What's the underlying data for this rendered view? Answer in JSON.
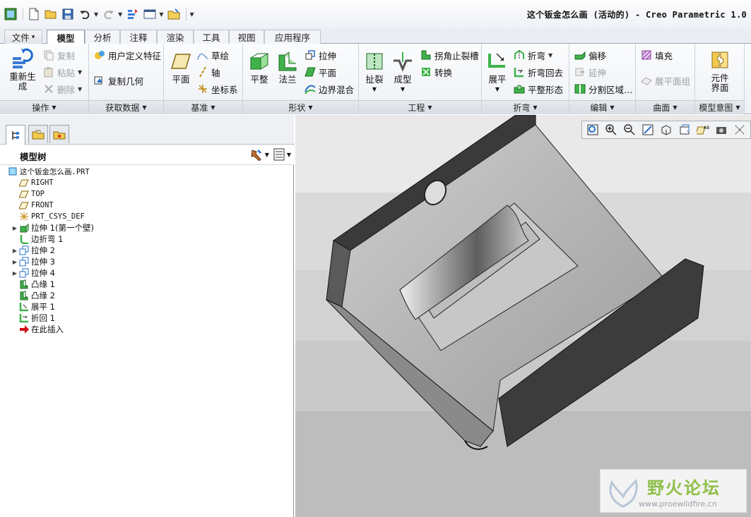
{
  "window": {
    "title": "这个钣金怎么画 (活动的) - Creo Parametric 1.0"
  },
  "tabs": [
    {
      "label": "文件",
      "dropdown": "▾"
    },
    {
      "label": "模型"
    },
    {
      "label": "分析"
    },
    {
      "label": "注释"
    },
    {
      "label": "渲染"
    },
    {
      "label": "工具"
    },
    {
      "label": "视图"
    },
    {
      "label": "应用程序"
    }
  ],
  "ribbon": {
    "groups": {
      "operations": {
        "label": "操作",
        "regenerate_line1": "重新生",
        "regenerate_line2": "成",
        "copy": "复制",
        "paste": "粘贴",
        "delete": "删除"
      },
      "get_data": {
        "label": "获取数据",
        "udf": "用户定义特征",
        "copy_geom": "复制几何"
      },
      "datum": {
        "label": "基准",
        "plane": "平面",
        "sketch": "草绘",
        "axis": "轴",
        "csys": "坐标系"
      },
      "shapes": {
        "label": "形状",
        "flat": "平整",
        "flange": "法兰",
        "extrude": "拉伸",
        "planar": "平面",
        "boundary_blend": "边界混合"
      },
      "engineering": {
        "label": "工程",
        "rip": "扯裂",
        "form": "成型",
        "corner_relief": "拐角止裂槽",
        "convert": "转换"
      },
      "bend": {
        "label": "折弯",
        "unbend": "展平",
        "bend": "折弯",
        "bend_back": "折弯回去",
        "flatten_form": "平整形态"
      },
      "edit": {
        "label": "编辑",
        "offset": "偏移",
        "extend": "延伸",
        "split_area": "分割区域…"
      },
      "surfaces": {
        "label": "曲面",
        "fill": "填充",
        "flat_quilt": "展平面组"
      },
      "model_intent": {
        "label": "模型意图",
        "component_line1": "元件",
        "component_line2": "界面"
      }
    }
  },
  "panel": {
    "tree_title": "模型树",
    "tree": [
      {
        "label": "这个钣金怎么画.PRT",
        "icon": "part-icon",
        "exp": ""
      },
      {
        "label": "RIGHT",
        "icon": "datum-plane-icon",
        "exp": ""
      },
      {
        "label": "TOP",
        "icon": "datum-plane-icon",
        "exp": ""
      },
      {
        "label": "FRONT",
        "icon": "datum-plane-icon",
        "exp": ""
      },
      {
        "label": "PRT_CSYS_DEF",
        "icon": "csys-icon",
        "exp": ""
      },
      {
        "label": "拉伸 1(第一个壁)",
        "icon": "first-wall-icon",
        "exp": "▶"
      },
      {
        "label": "边折弯 1",
        "icon": "edge-bend-icon",
        "exp": ""
      },
      {
        "label": "拉伸 2",
        "icon": "extrude-cut-icon",
        "exp": "▶"
      },
      {
        "label": "拉伸 3",
        "icon": "extrude-cut-icon",
        "exp": "▶"
      },
      {
        "label": "拉伸 4",
        "icon": "extrude-cut-icon",
        "exp": "▶"
      },
      {
        "label": "凸缘 1",
        "icon": "flange-icon",
        "exp": ""
      },
      {
        "label": "凸缘 2",
        "icon": "flange-icon",
        "exp": ""
      },
      {
        "label": "展平 1",
        "icon": "unbend-icon",
        "exp": ""
      },
      {
        "label": "折回 1",
        "icon": "bend-back-icon",
        "exp": ""
      },
      {
        "label": "在此插入",
        "icon": "insert-here-icon",
        "exp": ""
      }
    ]
  },
  "watermark": {
    "name": "野火论坛",
    "url": "www.proewildfire.cn"
  },
  "colors": {
    "accent": "#2a7fd4",
    "model_dark": "#3a3a3a",
    "model_light": "#b8b8b8",
    "insert_arrow": "#d01010"
  }
}
